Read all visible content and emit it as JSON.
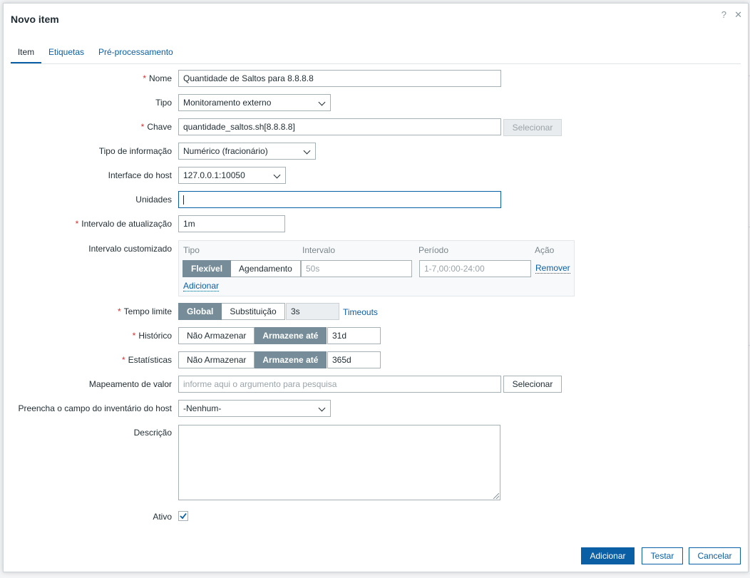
{
  "dialog": {
    "title": "Novo item",
    "help_icon": "question-icon",
    "close_icon": "close-icon",
    "help_glyph": "?",
    "close_glyph": "✕"
  },
  "tabs": [
    {
      "label": "Item",
      "active": true
    },
    {
      "label": "Etiquetas",
      "active": false
    },
    {
      "label": "Pré-processamento",
      "active": false
    }
  ],
  "form": {
    "required_mark": "*",
    "nome": {
      "label": "Nome",
      "value": "Quantidade de Saltos para 8.8.8.8"
    },
    "tipo": {
      "label": "Tipo",
      "value": "Monitoramento externo"
    },
    "chave": {
      "label": "Chave",
      "value": "quantidade_saltos.sh[8.8.8.8]",
      "button": "Selecionar"
    },
    "tipo_informacao": {
      "label": "Tipo de informação",
      "value": "Numérico (fracionário)"
    },
    "interface": {
      "label": "Interface do host",
      "value": "127.0.0.1:10050"
    },
    "unidades": {
      "label": "Unidades",
      "value": ""
    },
    "intervalo_atualizacao": {
      "label": "Intervalo de atualização",
      "value": "1m"
    },
    "intervalo_customizado": {
      "label": "Intervalo customizado",
      "headers": {
        "tipo": "Tipo",
        "intervalo": "Intervalo",
        "periodo": "Período",
        "acao": "Ação"
      },
      "options": [
        "Flexível",
        "Agendamento"
      ],
      "selected": "Flexível",
      "intervalo_placeholder": "50s",
      "periodo_placeholder": "1-7,00:00-24:00",
      "remove_link": "Remover",
      "add_link": "Adicionar"
    },
    "tempo_limite": {
      "label": "Tempo limite",
      "options": [
        "Global",
        "Substituição"
      ],
      "selected": "Global",
      "value": "3s",
      "link": "Timeouts"
    },
    "historico": {
      "label": "Histórico",
      "options": [
        "Não Armazenar",
        "Armazene até"
      ],
      "selected": "Armazene até",
      "value": "31d"
    },
    "estatisticas": {
      "label": "Estatísticas",
      "options": [
        "Não Armazenar",
        "Armazene até"
      ],
      "selected": "Armazene até",
      "value": "365d"
    },
    "mapeamento": {
      "label": "Mapeamento de valor",
      "placeholder": "informe aqui o argumento para pesquisa",
      "button": "Selecionar"
    },
    "inventario": {
      "label": "Preencha o campo do inventário do host",
      "value": "-Nenhum-"
    },
    "descricao": {
      "label": "Descrição",
      "value": ""
    },
    "ativo": {
      "label": "Ativo",
      "checked": true
    }
  },
  "footer": {
    "add": "Adicionar",
    "test": "Testar",
    "cancel": "Cancelar"
  },
  "colors": {
    "accent": "#0b5fa5",
    "segment_on": "#768d99",
    "required": "#d32f2f"
  }
}
